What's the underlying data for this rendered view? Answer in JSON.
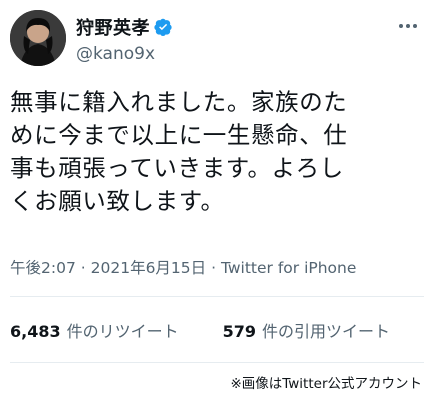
{
  "user": {
    "display_name": "狩野英孝",
    "handle": "@kano9x",
    "verified": true
  },
  "tweet": {
    "text": "無事に籍入れました。家族のた\nめに今まで以上に一生懸命、仕\n事も頑張っていきます。よろし\nくお願い致します。",
    "time": "午後2:07",
    "date": "2021年6月15日",
    "source": "Twitter for iPhone",
    "separator": "·"
  },
  "stats": {
    "retweets_count": "6,483",
    "retweets_label": "件のリツイート",
    "quotes_count": "579",
    "quotes_label": "件の引用ツイート"
  },
  "credit": "※画像はTwitter公式アカウント",
  "colors": {
    "text": "#0f1419",
    "muted": "#536471",
    "verified": "#1d9bf0",
    "divider": "#e6ecf0"
  },
  "icons": {
    "verified": "verified-badge-icon",
    "more": "more-options-icon"
  }
}
